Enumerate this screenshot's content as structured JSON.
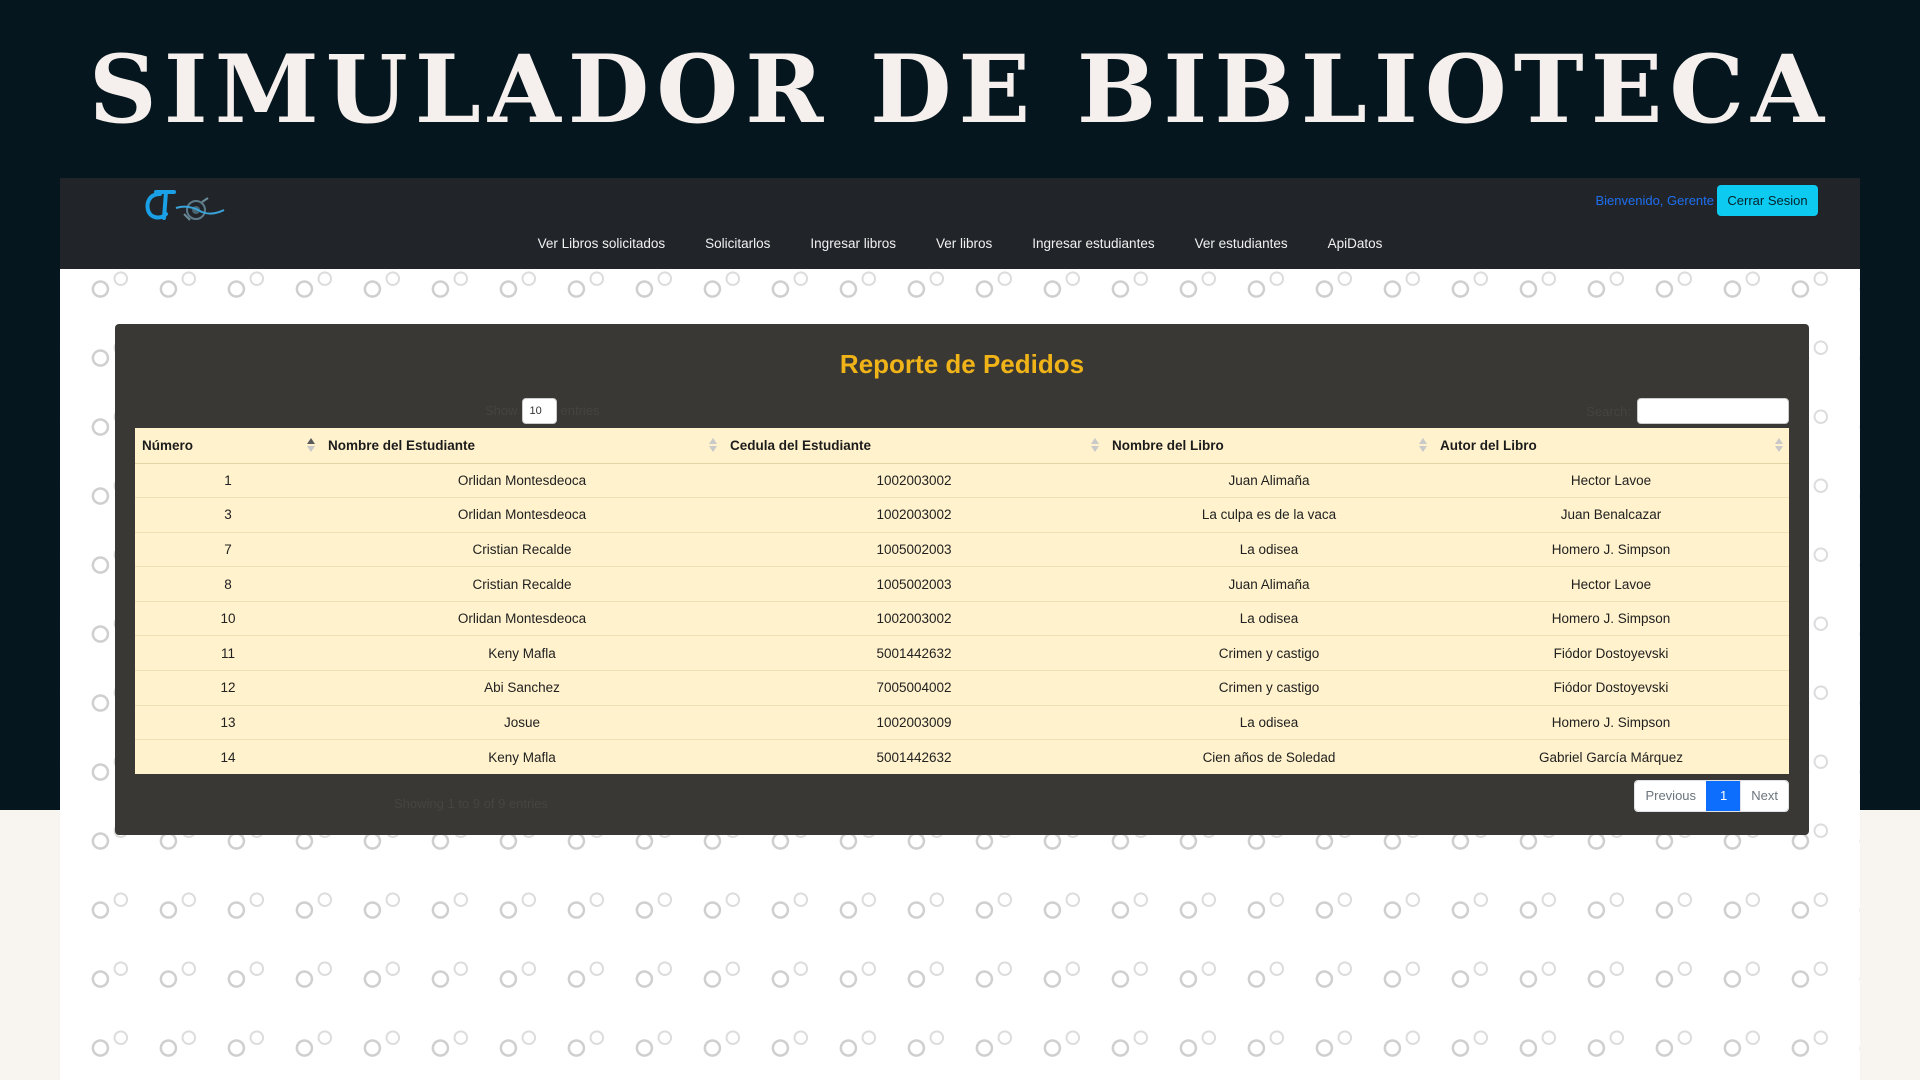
{
  "banner": {
    "title": "SIMULADOR DE BIBLIOTECA"
  },
  "navbar": {
    "welcome": "Bienvenido, Gerente",
    "logout_label": "Cerrar Sesion",
    "links": [
      {
        "label": "Ver Libros solicitados"
      },
      {
        "label": "Solicitarlos"
      },
      {
        "label": "Ingresar libros"
      },
      {
        "label": "Ver libros"
      },
      {
        "label": "Ingresar estudiantes"
      },
      {
        "label": "Ver estudiantes"
      },
      {
        "label": "ApiDatos"
      }
    ]
  },
  "report": {
    "title": "Reporte de Pedidos",
    "length_prefix": "Show",
    "length_value": "10",
    "length_suffix": "entries",
    "search_label": "Search:",
    "search_value": "",
    "columns": [
      "Número",
      "Nombre del Estudiante",
      "Cedula del Estudiante",
      "Nombre del Libro",
      "Autor del Libro"
    ],
    "rows": [
      [
        "1",
        "Orlidan Montesdeoca",
        "1002003002",
        "Juan Alimaña",
        "Hector Lavoe"
      ],
      [
        "3",
        "Orlidan Montesdeoca",
        "1002003002",
        "La culpa es de la vaca",
        "Juan Benalcazar"
      ],
      [
        "7",
        "Cristian Recalde",
        "1005002003",
        "La odisea",
        "Homero J. Simpson"
      ],
      [
        "8",
        "Cristian Recalde",
        "1005002003",
        "Juan Alimaña",
        "Hector Lavoe"
      ],
      [
        "10",
        "Orlidan Montesdeoca",
        "1002003002",
        "La odisea",
        "Homero J. Simpson"
      ],
      [
        "11",
        "Keny Mafla",
        "5001442632",
        "Crimen y castigo",
        "Fiódor Dostoyevski"
      ],
      [
        "12",
        "Abi Sanchez",
        "7005004002",
        "Crimen y castigo",
        "Fiódor Dostoyevski"
      ],
      [
        "13",
        "Josue",
        "1002003009",
        "La odisea",
        "Homero J. Simpson"
      ],
      [
        "14",
        "Keny Mafla",
        "5001442632",
        "Cien años de Soledad",
        "Gabriel García Márquez"
      ]
    ],
    "info": "Showing 1 to 9 of 9 entries",
    "pagination": {
      "previous": "Previous",
      "current": "1",
      "next": "Next"
    }
  },
  "colors": {
    "banner_bg": "#06161e",
    "navbar_bg": "#212529",
    "panel_bg": "#393834",
    "title_accent": "#f0b318",
    "table_bg": "#fff2cc",
    "button_info": "#0dcaf0",
    "link_blue": "#1d6ff2"
  },
  "icons": [
    "logo-icon",
    "sort-icon",
    "sort-asc-icon"
  ]
}
